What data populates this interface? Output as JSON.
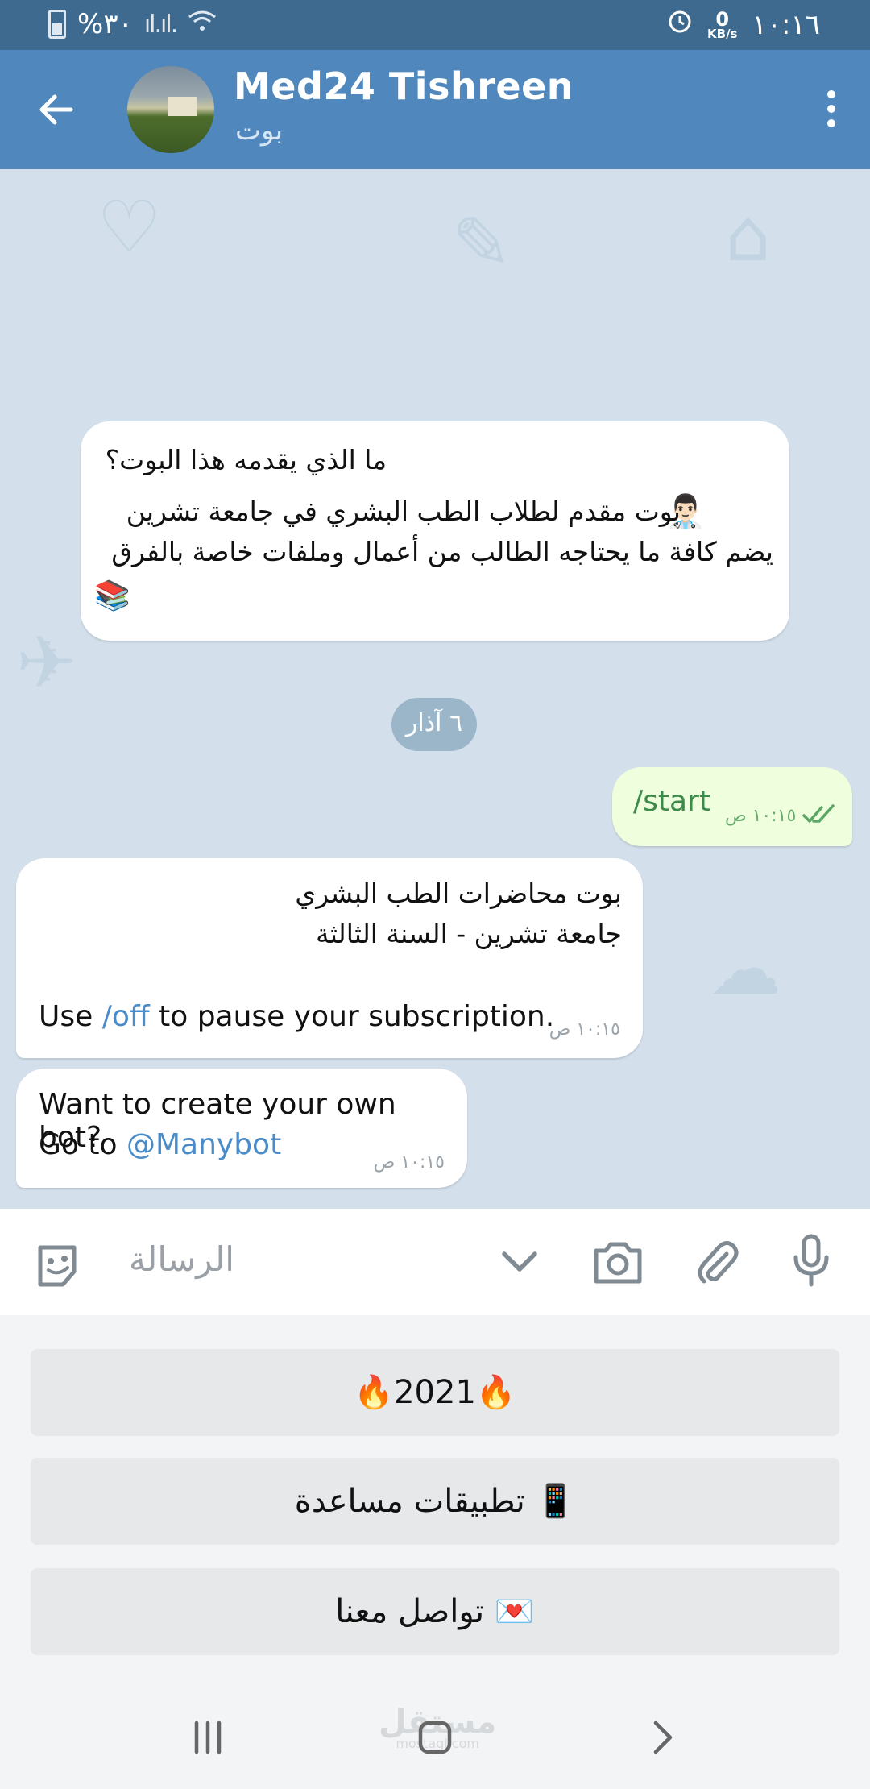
{
  "status": {
    "battery_text": "%٣٠",
    "speed_value": "0",
    "speed_unit": "KB/s",
    "time": "١٠:١٦"
  },
  "header": {
    "title": "Med24 Tishreen",
    "subtitle": "بوت"
  },
  "chat": {
    "intro": {
      "heading": "ما الذي يقدمه هذا البوت؟",
      "line1": "بوت مقدم لطلاب الطب البشري في جامعة تشرين",
      "line2": "يضم كافة ما يحتاجه الطالب من أعمال وملفات خاصة بالفرق",
      "doctor_emoji": "👨🏻‍⚕️",
      "books_emoji": "📚"
    },
    "date_chip": "٦ آذار",
    "outgoing": {
      "text": "/start",
      "time": "١٠:١٥ ص"
    },
    "bot_msg1": {
      "line1": "بوت محاضرات الطب البشري",
      "line2": "جامعة تشرين - السنة الثالثة",
      "use": "Use ",
      "cmd": "/off",
      "rest": " to pause your subscription.",
      "time": "١٠:١٥ ص"
    },
    "bot_msg2": {
      "line1": "Want to create your own bot?",
      "goto": "Go to ",
      "handle": "@Manybot",
      "time": "١٠:١٥ ص"
    }
  },
  "composer": {
    "placeholder": "الرسالة"
  },
  "keyboard": {
    "buttons": [
      "🔥2021🔥",
      "تطبيقات مساعدة 📱",
      "تواصل معنا 💌"
    ]
  },
  "watermark": {
    "text": "مستقل",
    "sub": "mostaql.com"
  },
  "icons": [
    "back-arrow-icon",
    "menu-dots-icon",
    "sticker-icon",
    "chevron-down-icon",
    "camera-icon",
    "paperclip-icon",
    "microphone-icon",
    "recents-icon",
    "home-icon",
    "back-nav-icon",
    "double-check-icon"
  ]
}
